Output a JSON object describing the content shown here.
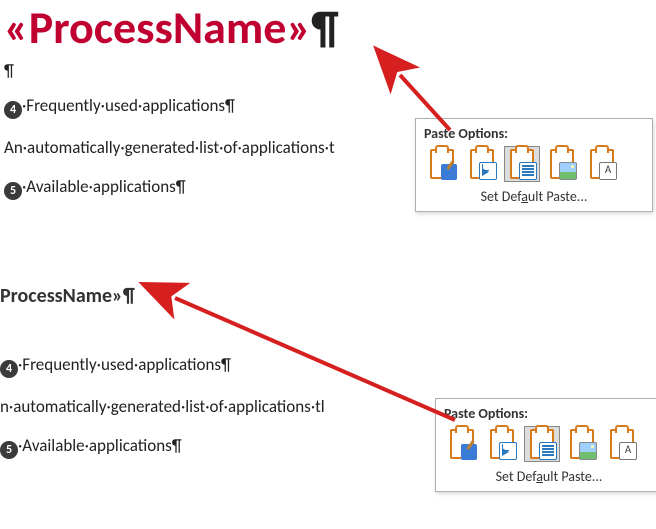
{
  "top": {
    "title": "«ProcessName»",
    "title_pilcrow": "¶",
    "empty_pilcrow": "¶",
    "line4": "·Frequently·used·applications¶",
    "body": "An·automatically·generated·list·of·applications·t",
    "line5": "·Available·applications¶"
  },
  "bottom": {
    "subheading": "ProcessName»¶",
    "line4": "·Frequently·used·applications¶",
    "body": "n·automatically·generated·list·of·applications·tl",
    "line5": "·Available·applications¶"
  },
  "bullets": {
    "four": "4",
    "five": "5"
  },
  "paste": {
    "label": "Paste Options:",
    "set_default_pre": "Set Def",
    "set_default_u": "a",
    "set_default_post": "ult Paste...",
    "icons": {
      "keep_source": "keep-source-formatting",
      "merge": "merge-formatting",
      "text_only": "keep-text-only",
      "picture": "picture",
      "unformatted": "unformatted-text"
    }
  },
  "colors": {
    "title": "#c00030",
    "bullet": "#3a3a3a",
    "arrow": "#d61f1f",
    "paste_border": "#b0b0b0"
  }
}
